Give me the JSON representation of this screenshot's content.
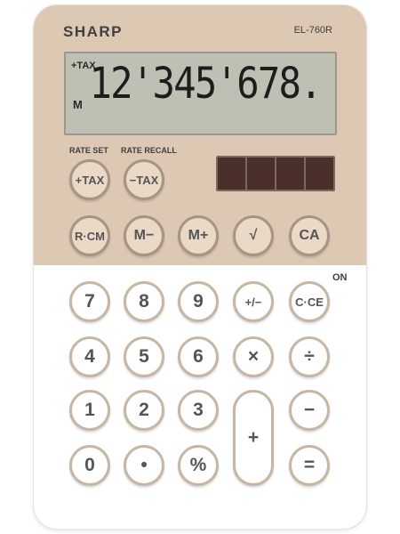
{
  "brand": "SHARP",
  "model": "EL-760R",
  "display": {
    "tax_indicator": "+TAX",
    "memory_indicator": "M",
    "value": "12'345'678."
  },
  "labels": {
    "rate_set": "RATE SET",
    "rate_recall": "RATE RECALL",
    "on": "ON"
  },
  "keys": {
    "plus_tax": "+TAX",
    "minus_tax": "−TAX",
    "rcm": "R·CM",
    "m_minus": "M−",
    "m_plus": "M+",
    "sqrt": "√",
    "ca": "CA",
    "seven": "7",
    "eight": "8",
    "nine": "9",
    "sign": "+/−",
    "cce": "C·CE",
    "four": "4",
    "five": "5",
    "six": "6",
    "multiply": "×",
    "divide": "÷",
    "one": "1",
    "two": "2",
    "three": "3",
    "plus": "+",
    "minus": "−",
    "zero": "0",
    "point": "•",
    "percent": "%",
    "equals": "="
  },
  "colors": {
    "top_panel": "#ddc8b4",
    "lcd": "#c0bfb4",
    "solar": "#4a2f2a"
  }
}
